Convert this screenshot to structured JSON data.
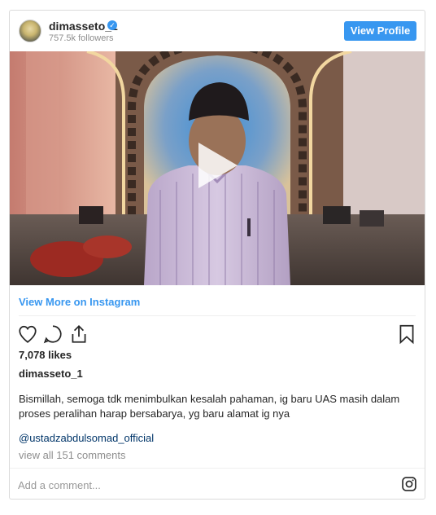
{
  "header": {
    "username": "dimasseto_1",
    "verified_icon": "verified-badge-icon",
    "followers": "757.5k followers",
    "view_profile_label": "View Profile"
  },
  "media": {
    "type": "video",
    "play_icon": "play-icon"
  },
  "view_more_label": "View More on Instagram",
  "actions": {
    "like_icon": "heart-icon",
    "comment_icon": "comment-icon",
    "share_icon": "share-icon",
    "save_icon": "bookmark-icon"
  },
  "likes": "7,078 likes",
  "post": {
    "owner": "dimasseto_1",
    "caption": "Bismillah, semoga tdk menimbulkan kesalah pahaman, ig baru UAS masih dalam proses peralihan harap bersabarya, yg baru alamat ig nya",
    "mention": "@ustadzabdulsomad_official",
    "view_comments": "view all 151 comments"
  },
  "comment": {
    "placeholder": "Add a comment...",
    "instagram_icon": "instagram-logo-icon"
  },
  "colors": {
    "accent": "#3897f0",
    "mention": "#003569",
    "muted": "#8e8e8e"
  }
}
